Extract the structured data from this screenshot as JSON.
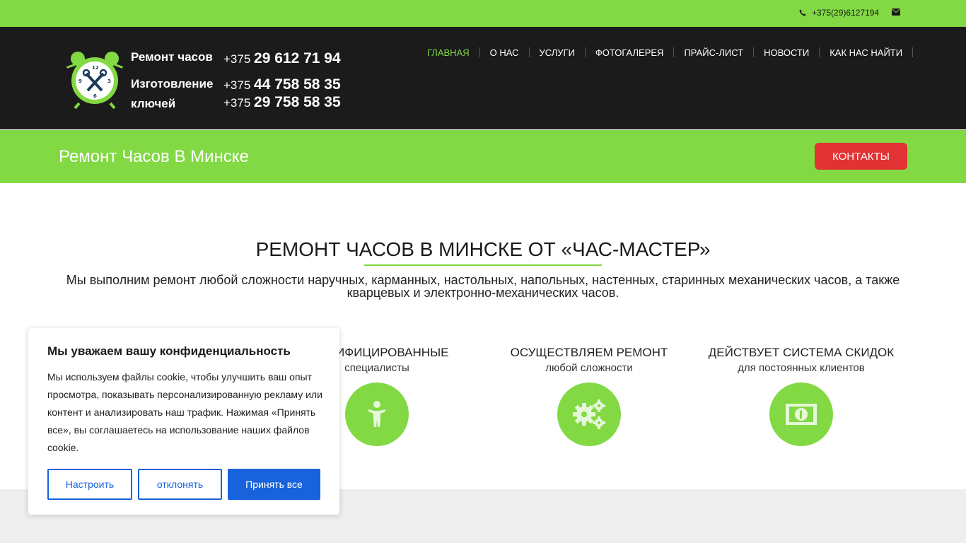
{
  "topbar": {
    "phone": "+375(29)6127194",
    "phone_icon": "phone-icon",
    "mail_icon": "envelope-icon"
  },
  "logo": {
    "line1": "Ремонт часов",
    "line2": "Изготовление",
    "line3": "ключей",
    "phones": [
      {
        "code": "+375",
        "number": "29 612 71 94"
      },
      {
        "code": "+375",
        "number": "44 758 58 35"
      },
      {
        "code": "+375",
        "number": "29 758 58 35"
      }
    ]
  },
  "nav": {
    "items": [
      {
        "label": "ГЛАВНАЯ",
        "active": true
      },
      {
        "label": "О НАС"
      },
      {
        "label": "УСЛУГИ"
      },
      {
        "label": "ФОТОГАЛЕРЕЯ"
      },
      {
        "label": "ПРАЙС-ЛИСТ"
      },
      {
        "label": "НОВОСТИ"
      },
      {
        "label": "КАК НАС НАЙТИ"
      }
    ]
  },
  "band": {
    "title": "Ремонт Часов В Минске",
    "contacts_label": "КОНТАКТЫ"
  },
  "main": {
    "heading": "РЕМОНТ ЧАСОВ В МИНСКЕ ОТ «ЧАС-МАСТЕР»",
    "description": "Мы выполним ремонт любой сложности наручных, карманных, настольных, напольных, настенных, старинных механических часов, а также кварцевых и электронно-механических часов."
  },
  "features": [
    {
      "title": "КВАЛИФИЦИРОВАННЫЕ",
      "subtitle": "специалисты",
      "icon": "person-icon"
    },
    {
      "title": "ОСУЩЕСТВЛЯЕМ РЕМОНТ",
      "subtitle": "любой сложности",
      "icon": "gears-icon"
    },
    {
      "title": "ДЕЙСТВУЕТ СИСТЕМА СКИДОК",
      "subtitle": "для постоянных клиентов",
      "icon": "money-icon"
    }
  ],
  "cookie": {
    "title": "Мы уважаем вашу конфиденциальность",
    "text": "Мы используем файлы cookie, чтобы улучшить ваш опыт просмотра, показывать персонализированную рекламу или контент и анализировать наш трафик. Нажимая «Принять все», вы соглашаетесь на использование наших файлов cookie.",
    "customize_label": "Настроить",
    "reject_label": "отклонять",
    "accept_label": "Принять все"
  },
  "colors": {
    "green": "#82d943",
    "dark": "#1b1b1b",
    "red": "#e23233",
    "blue": "#1863dc"
  }
}
